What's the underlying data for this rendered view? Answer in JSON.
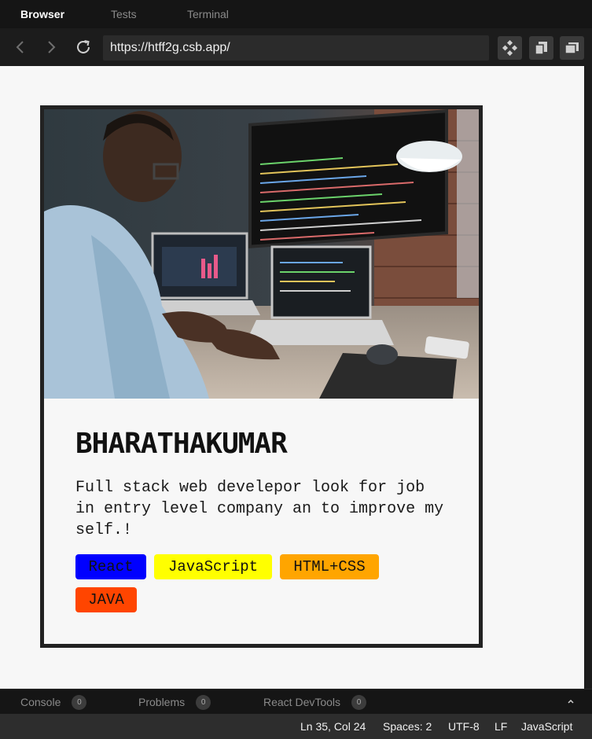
{
  "tabs": [
    {
      "label": "Browser",
      "active": true
    },
    {
      "label": "Tests",
      "active": false
    },
    {
      "label": "Terminal",
      "active": false
    }
  ],
  "navbar": {
    "url": "https://htff2g.csb.app/",
    "back_icon": "chevron-left-icon",
    "forward_icon": "chevron-right-icon",
    "reload_icon": "reload-icon"
  },
  "card": {
    "name": "BHARATHAKUMAR",
    "bio": "Full stack web develepor look for job in entry level company an to improve my self.!",
    "skills": [
      {
        "label": "React",
        "color": "#0000ff"
      },
      {
        "label": "JavaScript",
        "color": "#ffff00"
      },
      {
        "label": "HTML+CSS",
        "color": "#ffa500"
      },
      {
        "label": "JAVA",
        "color": "#ff4500"
      }
    ]
  },
  "devtools": {
    "tabs": [
      {
        "label": "Console",
        "count": "0"
      },
      {
        "label": "Problems",
        "count": "0"
      },
      {
        "label": "React DevTools",
        "count": "0"
      }
    ],
    "toggle_icon": "chevron-up-icon"
  },
  "statusbar": {
    "position": "Ln 35, Col 24",
    "spaces": "Spaces: 2",
    "encoding": "UTF-8",
    "eol": "LF",
    "language": "JavaScript"
  },
  "colors": {
    "chrome_bg": "#151515",
    "viewport_bg": "#f7f7f7",
    "card_border": "#222222"
  }
}
